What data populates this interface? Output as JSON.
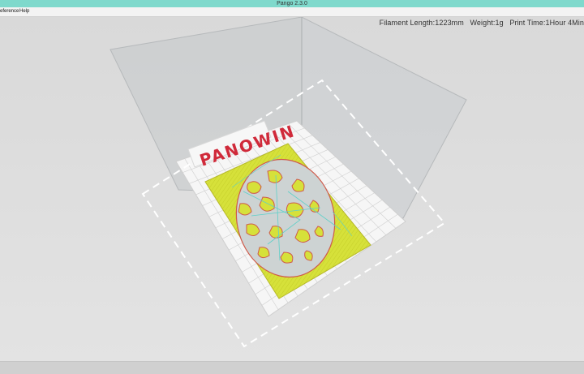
{
  "app": {
    "title": "Pango 2.3.0"
  },
  "menu": {
    "items": [
      "Preference",
      "Help"
    ]
  },
  "stats": {
    "filament_length": "Filament Length:1223mm",
    "weight": "Weight:1g",
    "print_time": "Print Time:1Hour 4Min"
  },
  "viewport": {
    "logo": "PANOWIN"
  },
  "colors": {
    "titlebar": "#7fd9cc",
    "logo": "#d02a3a",
    "print_fill": "#d6e13a",
    "print_travel": "#5ed0c9"
  }
}
